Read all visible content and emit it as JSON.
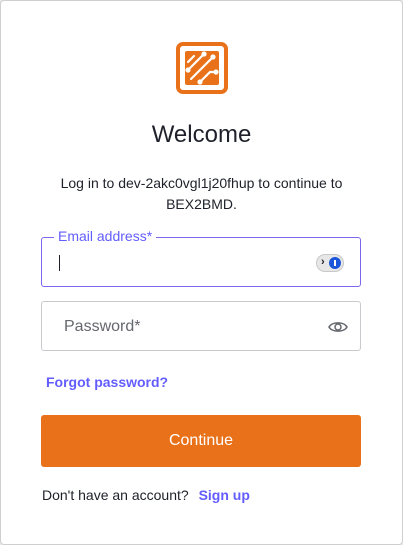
{
  "brand": {
    "logo_icon": "circuit-board-logo-icon",
    "accent_color": "#e8711a",
    "link_color": "#635dff"
  },
  "header": {
    "title": "Welcome",
    "subtitle": "Log in to dev-2akc0vgl1j20fhup to continue to BEX2BMD."
  },
  "email": {
    "label": "Email address*",
    "value": "",
    "password_manager_icon": "password-manager-icon"
  },
  "password": {
    "placeholder": "Password*",
    "toggle_icon": "eye-icon"
  },
  "forgot_password": "Forgot password?",
  "continue_label": "Continue",
  "signup": {
    "prompt": "Don't have an account?",
    "link": "Sign up"
  }
}
